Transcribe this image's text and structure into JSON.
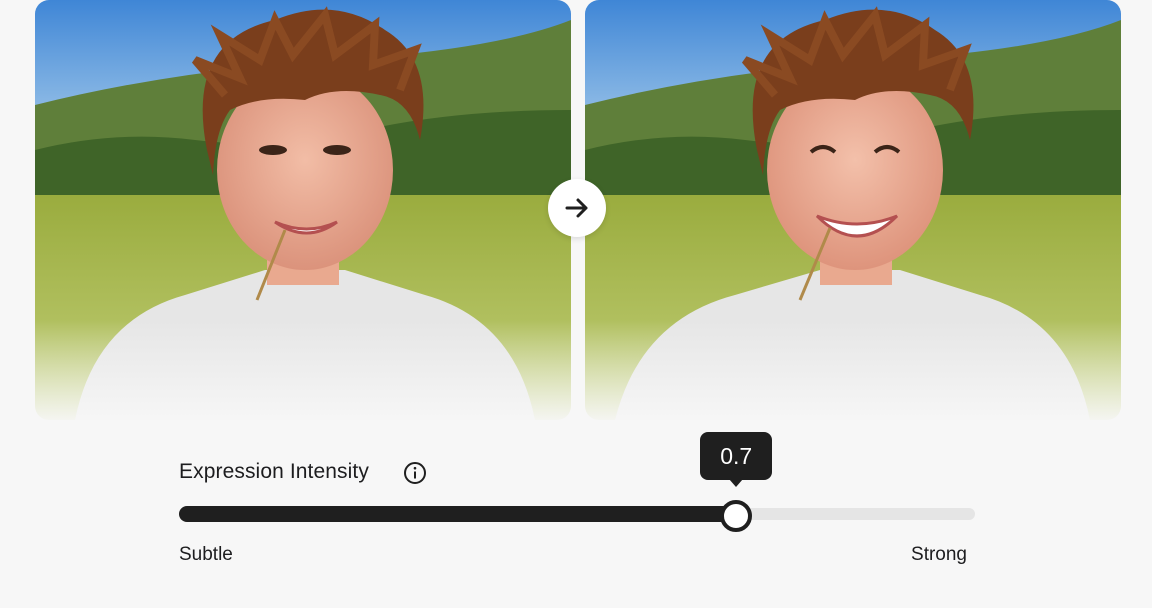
{
  "slider": {
    "label": "Expression Intensity",
    "value_display": "0.7",
    "value": 0.7,
    "min_label": "Subtle",
    "max_label": "Strong"
  },
  "icons": {
    "compare_arrow": "arrow-right-icon",
    "info": "info-icon"
  },
  "colors": {
    "background": "#f7f7f7",
    "accent": "#1f1f1f",
    "track": "#e5e5e5"
  }
}
